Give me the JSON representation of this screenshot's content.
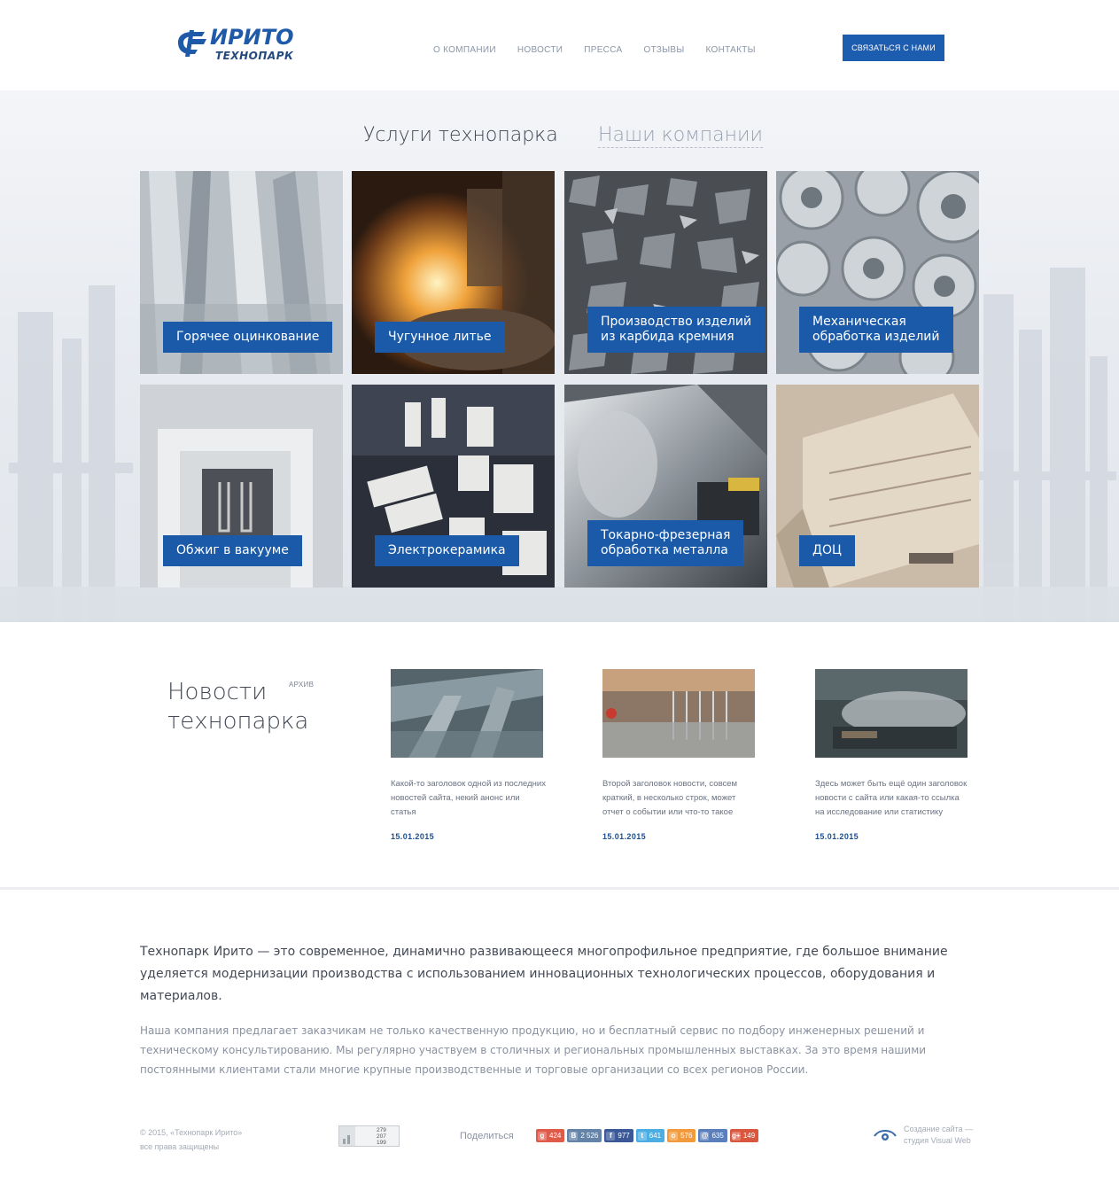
{
  "header": {
    "logo_title": "ИРИТО",
    "logo_sub": "ТЕХНОПАРК",
    "nav": [
      "О КОМПАНИИ",
      "НОВОСТИ",
      "ПРЕССА",
      "ОТЗЫВЫ",
      "КОНТАКТЫ"
    ],
    "contact_button": "СВЯЗАТЬСЯ С НАМИ"
  },
  "services": {
    "tab_active": "Услуги технопарка",
    "tab_inactive": "Наши компании",
    "tiles": [
      "Горячее оцинкование",
      "Чугунное литье",
      "Производство изделий\nиз карбида кремния",
      "Механическая\nобработка изделий",
      "Обжиг в вакууме",
      "Электрокерамика",
      "Токарно-фрезерная\nобработка металла",
      "ДОЦ"
    ]
  },
  "news": {
    "title": "Новости\nтехнопарка",
    "archive": "АРХИВ",
    "items": [
      {
        "text": "Какой-то заголовок одной из последних новостей сайта, некий анонс или статья",
        "date": "15.01.2015"
      },
      {
        "text": "Второй заголовок новости, совсем краткий, в несколько строк, может отчет о событии или что-то такое",
        "date": "15.01.2015"
      },
      {
        "text": "Здесь может быть ещё один заголовок новости с сайта или какая-то ссылка на исследование или статистику",
        "date": "15.01.2015"
      }
    ]
  },
  "about": {
    "lead": "Технопарк Ирито — это современное, динамично развивающееся многопрофильное предприятие, где большое внимание уделяется модернизации производства с использованием инновационных технологических процессов, оборудования и материалов.",
    "body": "Наша компания предлагает заказчикам не только качественную продукцию, но и бесплатный сервис по подбору инженерных решений и техническому консультированию. Мы регулярно участвуем в столичных и региональных промышленных выставках. За это время нашими постоянными клиентами стали многие крупные производственные и торговые организации со всех регионов России."
  },
  "footer": {
    "copyright_1": "© 2015, «Технопарк Ирито»",
    "copyright_2": "все права защищены",
    "counter": [
      "279",
      "207",
      "199"
    ],
    "share_label": "Поделиться",
    "shares": [
      {
        "icon": "g",
        "count": "424",
        "color": "#e05a4a"
      },
      {
        "icon": "В",
        "count": "2 526",
        "color": "#6383a8"
      },
      {
        "icon": "f",
        "count": "977",
        "color": "#3b5998"
      },
      {
        "icon": "t",
        "count": "641",
        "color": "#4aaee3"
      },
      {
        "icon": "о",
        "count": "576",
        "color": "#f39b3c"
      },
      {
        "icon": "@",
        "count": "635",
        "color": "#5b7fbd"
      },
      {
        "icon": "g+",
        "count": "149",
        "color": "#d9573f"
      }
    ],
    "studio_1": "Создание сайта —",
    "studio_2": "студия Visual Web"
  }
}
